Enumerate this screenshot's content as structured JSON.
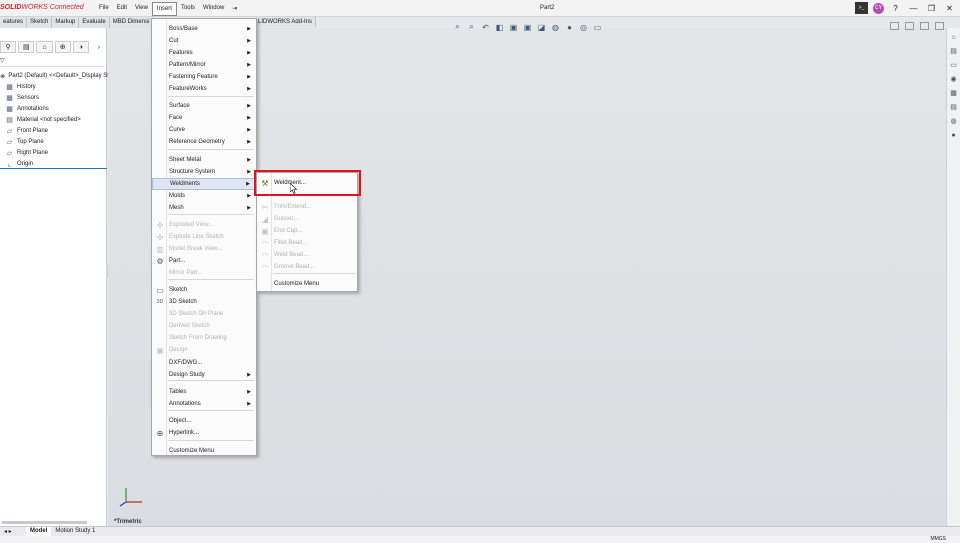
{
  "app": {
    "logo_brand": "SOLID",
    "logo_suffix": "WORKS Connected",
    "doc_title": "Part2"
  },
  "menubar": [
    "File",
    "Edit",
    "View",
    "Insert",
    "Tools",
    "Window"
  ],
  "window_controls": {
    "avatar": "CY",
    "icons": [
      "terminal-icon",
      "help-icon",
      "minimize-icon",
      "restore-icon",
      "close-icon"
    ]
  },
  "cmtabs": [
    "eatures",
    "Sketch",
    "Markup",
    "Evaluate",
    "MBD Dimensi"
  ],
  "cmtab_addins": "LIDWORKS Add-Ins",
  "feature_tree": {
    "root": "Part2 (Default) <<Default>_Display St",
    "nodes": [
      "History",
      "Sensors",
      "Annotations",
      "Material <not specified>",
      "Front Plane",
      "Top Plane",
      "Right Plane",
      "Origin"
    ]
  },
  "insert_menu": {
    "items": [
      {
        "label": "Boss/Base",
        "arrow": true
      },
      {
        "label": "Cut",
        "arrow": true
      },
      {
        "label": "Features",
        "arrow": true
      },
      {
        "label": "Pattern/Mirror",
        "arrow": true
      },
      {
        "label": "Fastening Feature",
        "arrow": true
      },
      {
        "label": "FeatureWorks",
        "arrow": true
      },
      {
        "label": "Surface",
        "arrow": true
      },
      {
        "label": "Face",
        "arrow": true
      },
      {
        "label": "Curve",
        "arrow": true
      },
      {
        "label": "Reference Geometry",
        "arrow": true
      },
      {
        "label": "Sheet Metal",
        "arrow": true
      },
      {
        "label": "Structure System",
        "arrow": true
      },
      {
        "label": "Weldments",
        "arrow": true
      },
      {
        "label": "Molds",
        "arrow": true
      },
      {
        "label": "Mesh",
        "arrow": true
      },
      {
        "label": "Exploded View...",
        "disabled": true
      },
      {
        "label": "Explode Line Sketch",
        "disabled": true
      },
      {
        "label": "Model Break View...",
        "disabled": true
      },
      {
        "label": "Part..."
      },
      {
        "label": "Mirror Part...",
        "disabled": true
      },
      {
        "label": "Sketch"
      },
      {
        "label": "3D Sketch"
      },
      {
        "label": "3D Sketch On Plane",
        "disabled": true
      },
      {
        "label": "Derived Sketch",
        "disabled": true
      },
      {
        "label": "Sketch From Drawing",
        "disabled": true
      },
      {
        "label": "Design",
        "disabled": true
      },
      {
        "label": "DXF/DWG..."
      },
      {
        "label": "Design Study",
        "arrow": true
      },
      {
        "label": "Tables",
        "arrow": true
      },
      {
        "label": "Annotations",
        "arrow": true
      },
      {
        "label": "Object..."
      },
      {
        "label": "Hyperlink..."
      },
      {
        "label": "Customize Menu"
      }
    ]
  },
  "weldments_menu": {
    "items": [
      {
        "label": "Weldment..."
      },
      {
        "label": "Trim/Extend...",
        "disabled": true
      },
      {
        "label": "Gusset...",
        "disabled": true
      },
      {
        "label": "End Cap...",
        "disabled": true
      },
      {
        "label": "Fillet Bead...",
        "disabled": true
      },
      {
        "label": "Weld Bead...",
        "disabled": true
      },
      {
        "label": "Groove Bead...",
        "disabled": true
      },
      {
        "label": "Customize Menu"
      }
    ]
  },
  "viewport": {
    "view_name": "*Trimetric"
  },
  "bottom_tabs": [
    "Model",
    "Motion Study 1"
  ],
  "status": {
    "units": "MMGS"
  },
  "colors": {
    "highlight_box": "#e0141e",
    "brand_red": "#d21f26",
    "tree_selection": "#1e70c9"
  }
}
